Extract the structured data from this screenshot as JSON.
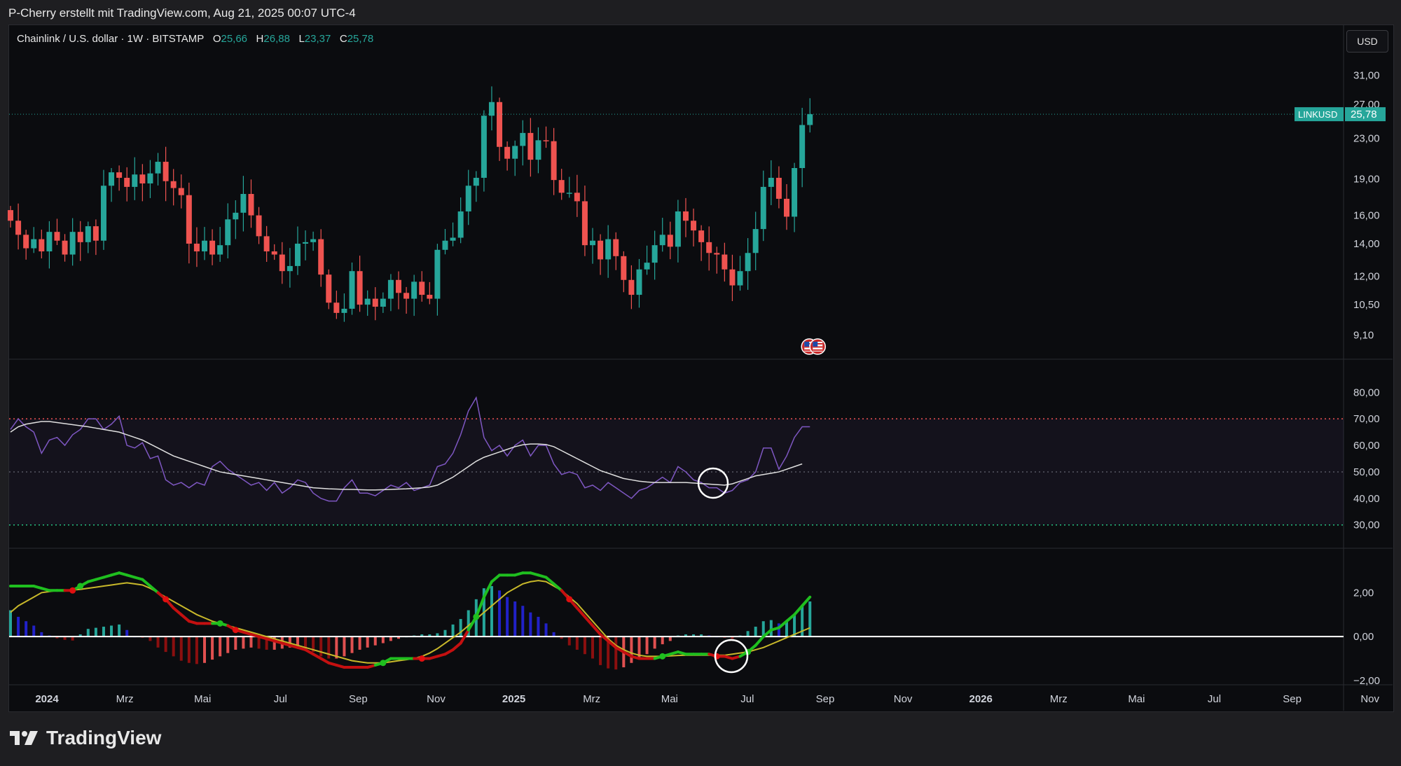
{
  "attribution": "P-Cherry erstellt mit TradingView.com, Aug 21, 2025 00:07 UTC-4",
  "legend": {
    "symbol": "Chainlink / U.S. dollar · 1W · BITSTAMP",
    "o_label": "O",
    "o": "25,66",
    "h_label": "H",
    "h": "26,88",
    "l_label": "L",
    "l": "23,37",
    "c_label": "C",
    "c": "25,78"
  },
  "currency_button": "USD",
  "price_tag": {
    "symbol": "LINKUSD",
    "value": "25,78"
  },
  "brand": "TradingView",
  "colors": {
    "up": "#26a69a",
    "down": "#ef5350",
    "rsi": "#7e57c2",
    "rsi_ma": "#e0e0e0",
    "macd": "#1fbf1f",
    "signal": "#c8b82a"
  },
  "chart_data": [
    {
      "type": "candlestick",
      "title": "Chainlink / U.S. dollar · 1W · BITSTAMP",
      "yscale": "log",
      "ylim": [
        8.2,
        36
      ],
      "price_ticks": [
        "31,00",
        "27,00",
        "23,00",
        "19,00",
        "16,00",
        "14,00",
        "12,00",
        "10,50",
        "9,10"
      ],
      "x_ticks": [
        "2024",
        "Mrz",
        "Mai",
        "Jul",
        "Sep",
        "Nov",
        "2025",
        "Mrz",
        "Mai",
        "Jul",
        "Sep",
        "Nov",
        "2026",
        "Mrz",
        "Mai",
        "Jul",
        "Sep",
        "Nov"
      ],
      "close": [
        15.6,
        14.6,
        13.7,
        14.3,
        13.5,
        14.8,
        14.2,
        13.3,
        14.8,
        14.1,
        15.2,
        14.2,
        18.4,
        19.6,
        19.1,
        18.3,
        19.4,
        18.6,
        19.5,
        20.6,
        18.8,
        18.2,
        17.6,
        14.0,
        13.5,
        14.2,
        13.3,
        13.9,
        15.7,
        16.2,
        17.7,
        16.0,
        14.5,
        13.5,
        13.3,
        12.3,
        12.6,
        14.0,
        14.1,
        14.3,
        12.1,
        10.6,
        10.1,
        10.3,
        12.3,
        10.5,
        10.8,
        10.4,
        10.8,
        11.8,
        11.1,
        10.8,
        11.7,
        11.0,
        10.8,
        13.6,
        14.2,
        14.4,
        16.3,
        18.4,
        19.1,
        25.6,
        27.3,
        22.1,
        20.9,
        22.2,
        23.6,
        20.8,
        22.8,
        22.7,
        18.9,
        17.8,
        17.8,
        17.1,
        13.9,
        14.2,
        13.0,
        14.3,
        13.2,
        11.8,
        11.0,
        12.4,
        12.8,
        13.9,
        14.6,
        13.8,
        16.3,
        15.6,
        14.9,
        14.1,
        13.4,
        13.3,
        12.4,
        11.5,
        12.3,
        13.4,
        15.0,
        18.3,
        19.1,
        17.3,
        15.9,
        20.0,
        24.5,
        25.78
      ],
      "markers": [
        "us-flag-icon",
        "us-flag-icon"
      ]
    },
    {
      "type": "line",
      "ylim": [
        22,
        88
      ],
      "y_ticks": [
        "80,00",
        "70,00",
        "60,00",
        "50,00",
        "40,00",
        "30,00"
      ],
      "levels": [
        70,
        50,
        30
      ],
      "series": [
        {
          "values": [
            66,
            70,
            67,
            65,
            57,
            62,
            63,
            60,
            64,
            66,
            70,
            70,
            66,
            68,
            71,
            60,
            59,
            61,
            55,
            56,
            47,
            45,
            46,
            44,
            46,
            45,
            52,
            54,
            51,
            49,
            47,
            45,
            46,
            43,
            46,
            42,
            44,
            47,
            46,
            42,
            40,
            39,
            39,
            44,
            47,
            42,
            42,
            41,
            43,
            45,
            44,
            46,
            43,
            44,
            45,
            52,
            53,
            57,
            64,
            73,
            78,
            63,
            58,
            60,
            56,
            60,
            62,
            56,
            60,
            60,
            53,
            49,
            50,
            49,
            44,
            45,
            43,
            46,
            44,
            42,
            40,
            43,
            44,
            46,
            48,
            46,
            52,
            50,
            47,
            46,
            44,
            44,
            42,
            43,
            46,
            47,
            50,
            59,
            59,
            51,
            56,
            63,
            67,
            67
          ]
        },
        {
          "values": [
            65,
            67,
            68,
            68.5,
            69,
            69,
            68.6,
            68.2,
            67.8,
            67.4,
            67,
            66.5,
            66,
            65.5,
            65,
            64,
            63,
            62,
            60.5,
            59,
            57.5,
            56,
            55,
            54,
            53,
            52,
            51,
            50,
            49.5,
            49,
            48.5,
            48,
            47.5,
            47,
            46.5,
            46,
            45.5,
            45,
            44.5,
            44,
            43.8,
            43.6,
            43.5,
            43.4,
            43.4,
            43.3,
            43.2,
            43.2,
            43.3,
            43.4,
            43.5,
            43.6,
            43.8,
            44,
            44.3,
            45,
            46.5,
            48,
            50,
            52,
            54,
            55.5,
            56.5,
            57.5,
            58.5,
            59.5,
            60.2,
            60.5,
            60.5,
            60.3,
            59.5,
            58,
            56.5,
            55,
            53.5,
            52,
            50.5,
            49.5,
            48.5,
            47.5,
            47,
            46.5,
            46.2,
            46,
            46,
            46,
            46,
            46,
            45.8,
            45.6,
            45.4,
            45.2,
            45,
            45.5,
            46.5,
            47.5,
            48.5,
            49,
            49.5,
            50,
            51,
            52,
            53
          ]
        }
      ]
    },
    {
      "type": "bar",
      "ylim": [
        -2.1,
        3.8
      ],
      "y_ticks": [
        "2,00",
        "0,00",
        "−2,00"
      ],
      "values": [
        1.2,
        0.9,
        0.7,
        0.5,
        0.2,
        0.05,
        -0.08,
        -0.15,
        -0.18,
        0.1,
        0.35,
        0.4,
        0.45,
        0.5,
        0.55,
        0.3,
        0,
        -0.05,
        -0.2,
        -0.5,
        -0.7,
        -0.9,
        -1.1,
        -1.2,
        -1.25,
        -1.2,
        -1.05,
        -0.9,
        -0.75,
        -0.6,
        -0.55,
        -0.5,
        -0.55,
        -0.6,
        -0.6,
        -0.55,
        -0.5,
        -0.5,
        -0.55,
        -0.7,
        -0.9,
        -1.0,
        -1.0,
        -0.9,
        -0.75,
        -0.6,
        -0.5,
        -0.4,
        -0.3,
        -0.2,
        -0.1,
        0,
        0.05,
        0.1,
        0.1,
        0.15,
        0.3,
        0.55,
        0.8,
        1.2,
        1.7,
        2.2,
        2.3,
        2.1,
        1.8,
        1.6,
        1.4,
        1.1,
        0.9,
        0.6,
        0.2,
        -0.1,
        -0.4,
        -0.6,
        -0.8,
        -1.0,
        -1.3,
        -1.45,
        -1.5,
        -1.4,
        -1.2,
        -1.0,
        -0.8,
        -0.55,
        -0.35,
        -0.2,
        0.05,
        0.1,
        0.1,
        0.1,
        0.05,
        0,
        -0.05,
        -0.1,
        0.05,
        0.25,
        0.45,
        0.7,
        0.75,
        0.6,
        0.7,
        1.0,
        1.4,
        1.6
      ],
      "series": [
        {
          "values": [
            2.3,
            2.3,
            2.3,
            2.3,
            2.2,
            2.1,
            2.1,
            2.1,
            2.1,
            2.3,
            2.5,
            2.6,
            2.7,
            2.8,
            2.9,
            2.8,
            2.7,
            2.6,
            2.3,
            2.0,
            1.7,
            1.3,
            1.0,
            0.7,
            0.6,
            0.6,
            0.6,
            0.6,
            0.5,
            0.3,
            0.2,
            0.1,
            0.0,
            -0.1,
            -0.2,
            -0.3,
            -0.4,
            -0.5,
            -0.6,
            -0.8,
            -1.0,
            -1.2,
            -1.3,
            -1.4,
            -1.4,
            -1.4,
            -1.4,
            -1.3,
            -1.2,
            -1.0,
            -1.0,
            -1.0,
            -1.0,
            -1.0,
            -1.0,
            -0.9,
            -0.8,
            -0.6,
            -0.3,
            0.3,
            0.9,
            1.8,
            2.5,
            2.8,
            2.8,
            2.8,
            2.9,
            2.9,
            2.8,
            2.7,
            2.4,
            2.1,
            1.7,
            1.3,
            0.9,
            0.5,
            0.1,
            -0.2,
            -0.5,
            -0.7,
            -0.9,
            -1.0,
            -1.0,
            -1.0,
            -0.9,
            -0.8,
            -0.7,
            -0.8,
            -0.8,
            -0.8,
            -0.8,
            -0.9,
            -0.9,
            -1.0,
            -0.9,
            -0.7,
            -0.4,
            0.0,
            0.3,
            0.4,
            0.7,
            1.0,
            1.4,
            1.8
          ]
        },
        {
          "values": [
            1.1,
            1.4,
            1.6,
            1.8,
            2.0,
            2.05,
            2.1,
            2.1,
            2.12,
            2.15,
            2.2,
            2.25,
            2.3,
            2.35,
            2.4,
            2.45,
            2.4,
            2.35,
            2.2,
            2.0,
            1.8,
            1.6,
            1.4,
            1.2,
            1.0,
            0.85,
            0.7,
            0.6,
            0.5,
            0.4,
            0.3,
            0.2,
            0.1,
            0.0,
            -0.1,
            -0.2,
            -0.3,
            -0.4,
            -0.5,
            -0.6,
            -0.7,
            -0.8,
            -0.9,
            -1.0,
            -1.1,
            -1.15,
            -1.2,
            -1.2,
            -1.2,
            -1.15,
            -1.1,
            -1.05,
            -1.0,
            -0.9,
            -0.75,
            -0.55,
            -0.3,
            -0.05,
            0.2,
            0.5,
            0.8,
            1.1,
            1.4,
            1.7,
            2.0,
            2.2,
            2.4,
            2.5,
            2.55,
            2.5,
            2.3,
            2.1,
            1.8,
            1.5,
            1.1,
            0.7,
            0.3,
            -0.1,
            -0.4,
            -0.6,
            -0.75,
            -0.85,
            -0.9,
            -0.9,
            -0.9,
            -0.88,
            -0.86,
            -0.85,
            -0.85,
            -0.85,
            -0.85,
            -0.85,
            -0.85,
            -0.8,
            -0.75,
            -0.7,
            -0.6,
            -0.5,
            -0.35,
            -0.2,
            -0.05,
            0.1,
            0.25,
            0.4
          ]
        }
      ]
    }
  ]
}
